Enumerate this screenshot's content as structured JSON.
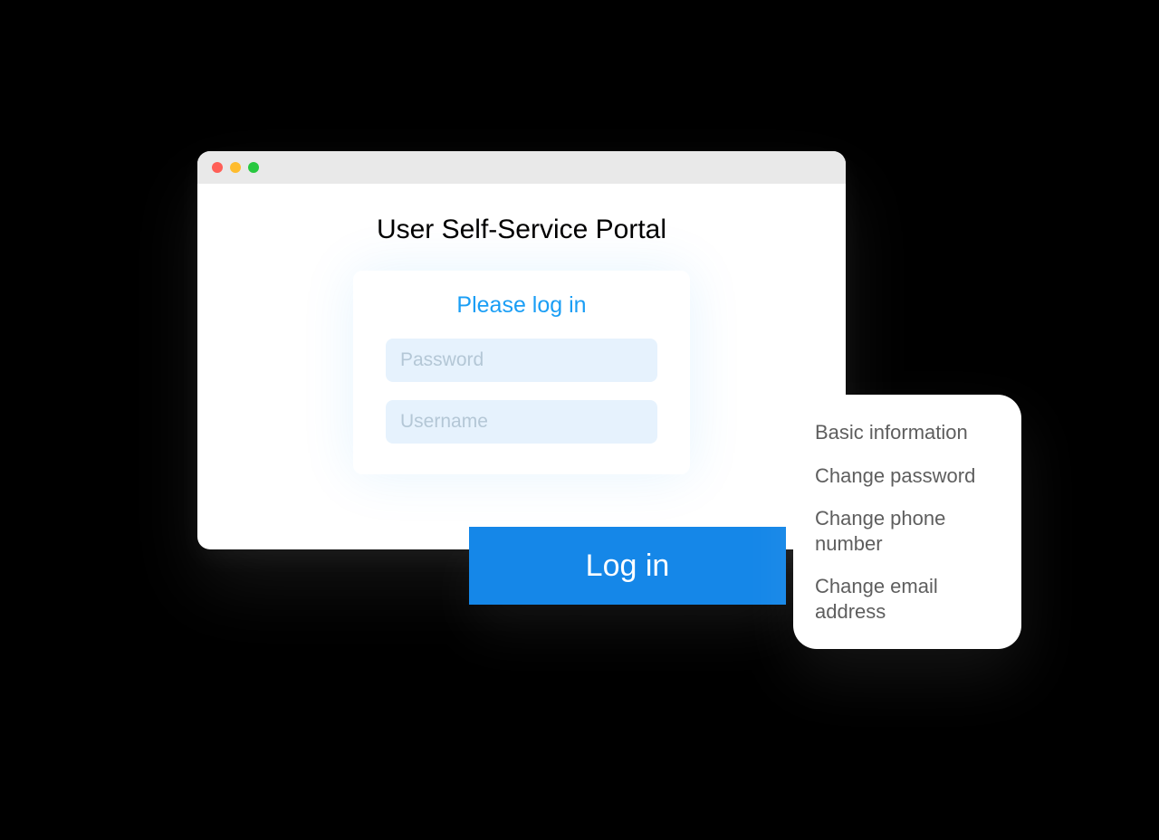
{
  "window": {
    "title": "User Self-Service Portal"
  },
  "login": {
    "heading": "Please log in",
    "password_placeholder": "Password",
    "username_placeholder": "Username",
    "button_label": "Log in"
  },
  "menu": {
    "items": [
      "Basic information",
      "Change password",
      "Change phone number",
      "Change email address"
    ]
  }
}
